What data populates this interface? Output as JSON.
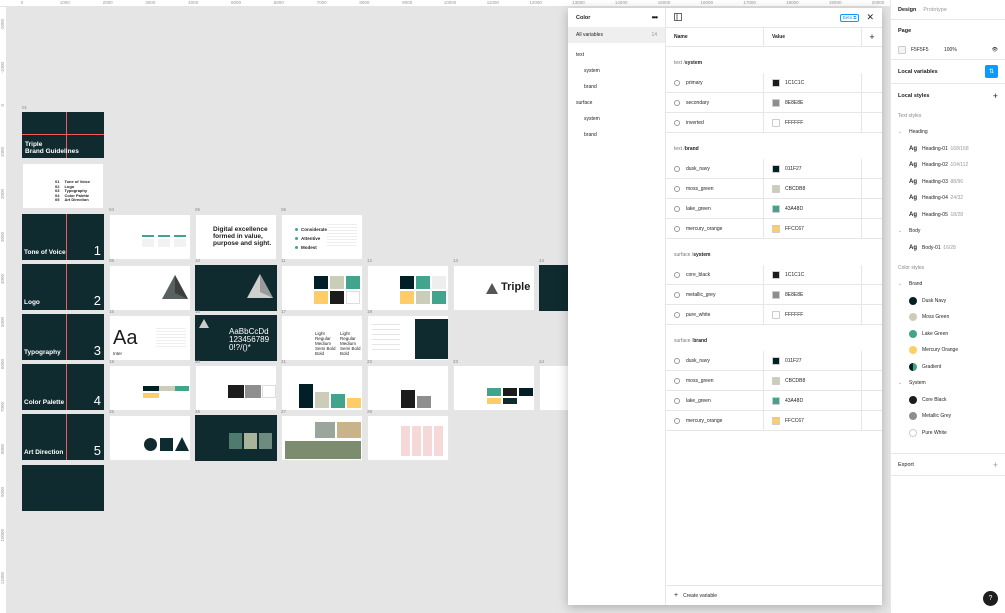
{
  "ruler_top": [
    "0",
    "1000",
    "2000",
    "3000",
    "4000",
    "5000",
    "6000",
    "7000",
    "8000",
    "9000",
    "10000",
    "11000",
    "12000",
    "13000",
    "14000",
    "15000",
    "16000",
    "17000",
    "18000",
    "19000",
    "20000"
  ],
  "ruler_left": [
    "-2000",
    "-1000",
    "0",
    "1000",
    "2000",
    "3000",
    "4000",
    "5000",
    "6000",
    "7000",
    "8000",
    "9000",
    "10000",
    "11000"
  ],
  "canvas": {
    "frame_labels": [
      "01",
      "04",
      "05",
      "06",
      "08",
      "10",
      "11",
      "12",
      "13",
      "14",
      "15",
      "16",
      "17",
      "18",
      "19",
      "20",
      "21",
      "22",
      "23",
      "24",
      "25",
      "26",
      "27",
      "28",
      "29",
      "30",
      "31",
      "32",
      "33"
    ],
    "cover_title": "Triple\nBrand Guidelines",
    "toc": [
      {
        "num": "01",
        "label": "Tone of Voice"
      },
      {
        "num": "02",
        "label": "Logo"
      },
      {
        "num": "03",
        "label": "Typography"
      },
      {
        "num": "04",
        "label": "Color Palette"
      },
      {
        "num": "05",
        "label": "Art Direction"
      }
    ],
    "sections": [
      {
        "title": "Tone of Voice",
        "num": "1"
      },
      {
        "title": "Logo",
        "num": "2"
      },
      {
        "title": "Typography",
        "num": "3"
      },
      {
        "title": "Color Palette",
        "num": "4"
      },
      {
        "title": "Art Direction",
        "num": "5"
      }
    ],
    "excellence": "Digital excellence formed in value, purpose and sight.",
    "bullets": [
      "Considerate",
      "Attentive",
      "Modest"
    ],
    "wordmark": "Triple",
    "type_sample": "Aa",
    "type_sample_name": "Inter",
    "glyphs": "AaBbCcDd\n123456789\n0!?/()*",
    "weights": [
      "Light",
      "Regular",
      "Medium",
      "Semi Bold",
      "Bold"
    ]
  },
  "modal": {
    "title": "Color",
    "more_icon": "more-icon",
    "collections": [
      {
        "label": "All variables",
        "count": "14"
      }
    ],
    "groups": [
      {
        "label": "text",
        "indent": false
      },
      {
        "label": "system",
        "indent": true
      },
      {
        "label": "brand",
        "indent": true
      },
      {
        "label": "surface",
        "indent": false
      },
      {
        "label": "system",
        "indent": true
      },
      {
        "label": "brand",
        "indent": true
      }
    ],
    "beta": "Beta",
    "col_name": "Name",
    "col_value": "Value",
    "sections": [
      {
        "prefix": "text / ",
        "name": "system",
        "rows": [
          {
            "name": "primary",
            "value": "1C1C1C",
            "color": "#1C1C1C"
          },
          {
            "name": "secondary",
            "value": "8E8E8E",
            "color": "#8E8E8E"
          },
          {
            "name": "inverted",
            "value": "FFFFFF",
            "color": "#FFFFFF"
          }
        ]
      },
      {
        "prefix": "text / ",
        "name": "brand",
        "rows": [
          {
            "name": "dusk_navy",
            "value": "011F27",
            "color": "#011F27"
          },
          {
            "name": "moss_green",
            "value": "CBCDB8",
            "color": "#CBCDB8"
          },
          {
            "name": "lake_green",
            "value": "43A48D",
            "color": "#43A48D"
          },
          {
            "name": "mercury_orange",
            "value": "FFCC67",
            "color": "#FFCC67"
          }
        ]
      },
      {
        "prefix": "surface / ",
        "name": "system",
        "rows": [
          {
            "name": "core_black",
            "value": "1C1C1C",
            "color": "#1C1C1C"
          },
          {
            "name": "metallic_grey",
            "value": "8E8E8E",
            "color": "#8E8E8E"
          },
          {
            "name": "pure_white",
            "value": "FFFFFF",
            "color": "#FFFFFF"
          }
        ]
      },
      {
        "prefix": "surface / ",
        "name": "brand",
        "rows": [
          {
            "name": "dusk_navy",
            "value": "011F27",
            "color": "#011F27"
          },
          {
            "name": "moss_green",
            "value": "CBCDB8",
            "color": "#CBCDB8"
          },
          {
            "name": "lake_green",
            "value": "43A48D",
            "color": "#43A48D"
          },
          {
            "name": "mercury_orange",
            "value": "FFCC67",
            "color": "#FFCC67"
          }
        ]
      }
    ],
    "create_label": "Create variable"
  },
  "panel": {
    "tabs": [
      "Design",
      "Prototype"
    ],
    "page_label": "Page",
    "page_color": "F5F5F5",
    "page_opacity": "100%",
    "local_variables": "Local variables",
    "local_styles": "Local styles",
    "text_styles": "Text styles",
    "text_groups": [
      {
        "label": "Heading",
        "items": [
          {
            "name": "Heading-01",
            "meta": "168/168"
          },
          {
            "name": "Heading-02",
            "meta": "104/112"
          },
          {
            "name": "Heading-03",
            "meta": "88/96"
          },
          {
            "name": "Heading-04",
            "meta": "24/32"
          },
          {
            "name": "Heading-05",
            "meta": "18/28"
          }
        ]
      },
      {
        "label": "Body",
        "items": [
          {
            "name": "Body-01",
            "meta": "16/28"
          }
        ]
      }
    ],
    "color_styles": "Color styles",
    "color_groups": [
      {
        "label": "Brand",
        "items": [
          {
            "name": "Dusk Navy",
            "color": "#011F27"
          },
          {
            "name": "Moss Green",
            "color": "#CBCDB8"
          },
          {
            "name": "Lake Green",
            "color": "#43A48D"
          },
          {
            "name": "Mercury Orange",
            "color": "#FFCC67"
          },
          {
            "name": "Gradient",
            "color": "linear-gradient(90deg,#011F27 50%,#43A48D 50%)"
          }
        ]
      },
      {
        "label": "System",
        "items": [
          {
            "name": "Core Black",
            "color": "#1C1C1C"
          },
          {
            "name": "Metallic Grey",
            "color": "#8E8E8E"
          },
          {
            "name": "Pure White",
            "color": "#FFFFFF"
          }
        ]
      }
    ],
    "export": "Export",
    "help": "?"
  },
  "colors": {
    "accent": "#0d99ff",
    "frame_red": "#f35b5b",
    "dark_frame": "#0f2b2f"
  }
}
